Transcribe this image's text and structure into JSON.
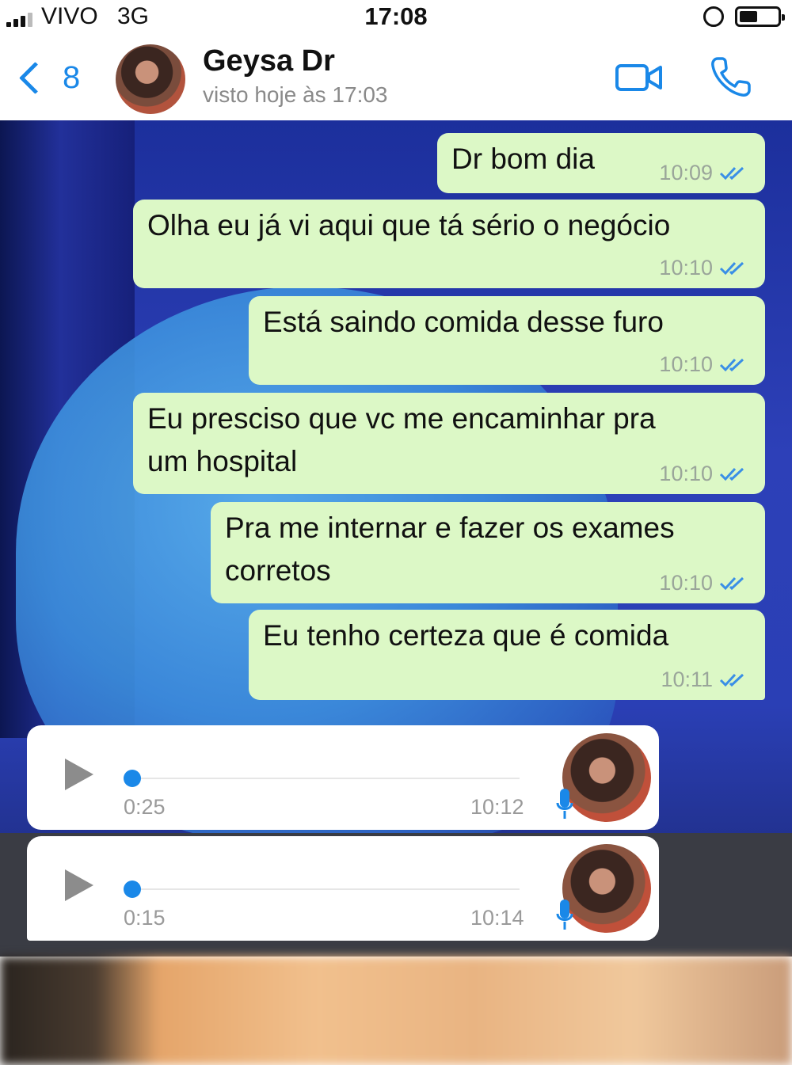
{
  "status_bar": {
    "carrier": "VIVO",
    "network": "3G",
    "time": "17:08"
  },
  "header": {
    "back_count": "8",
    "contact_name": "Geysa Dr",
    "last_seen": "visto hoje às 17:03"
  },
  "colors": {
    "accent": "#1a88e8",
    "outgoing_bubble": "#dcf8c6",
    "incoming_bubble": "#ffffff"
  },
  "messages": [
    {
      "text": "Dr bom dia",
      "time": "10:09"
    },
    {
      "text": "Olha eu já vi aqui que tá sério o negócio",
      "time": "10:10"
    },
    {
      "text": "Está saindo comida desse furo",
      "time": "10:10"
    },
    {
      "text_line1": "Eu presciso que vc me encaminhar pra",
      "text_line2": "um hospital",
      "time": "10:10"
    },
    {
      "text_line1": "Pra me internar e fazer os exames",
      "text_line2": "corretos",
      "time": "10:10"
    },
    {
      "text": "Eu tenho certeza que é comida",
      "time": "10:11"
    }
  ],
  "voice_messages": [
    {
      "duration": "0:25",
      "time": "10:12"
    },
    {
      "duration": "0:15",
      "time": "10:14"
    }
  ],
  "icons": {
    "back": "chevron-left-icon",
    "video": "video-camera-icon",
    "phone": "phone-icon",
    "read": "double-check-icon",
    "play": "play-icon",
    "mic": "microphone-icon"
  }
}
